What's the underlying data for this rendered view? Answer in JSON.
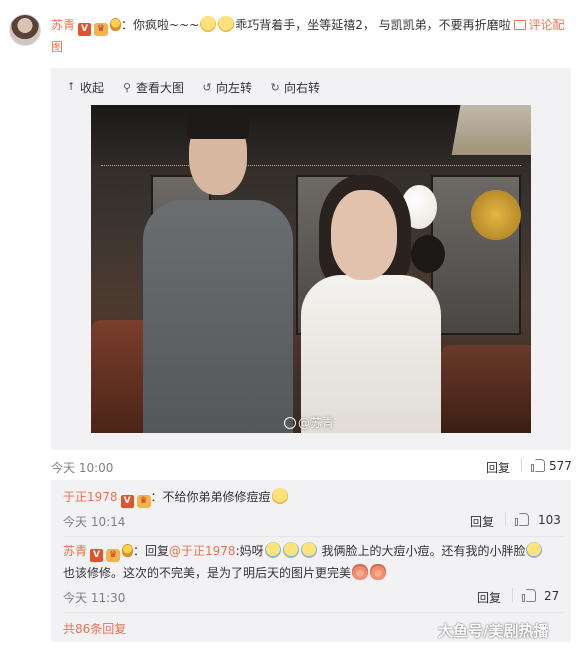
{
  "post": {
    "author": "苏青",
    "text_part1": "：你疯啦~~~",
    "text_part2": "乖巧背着手，坐等延禧2， 与凯凯弟，不要再折磨啦",
    "pic_link_a": "评论配",
    "pic_link_b": "图"
  },
  "toolbar": {
    "collapse": "收起",
    "view_large": "查看大图",
    "rotate_left": "向左转",
    "rotate_right": "向右转"
  },
  "photo": {
    "watermark": "@苏青"
  },
  "post_meta": {
    "time": "今天 10:00",
    "reply": "回复",
    "likes": "577"
  },
  "replies": [
    {
      "author": "于正1978",
      "text": "：不给你弟弟修修痘痘",
      "time": "今天 10:14",
      "reply": "回复",
      "likes": "103"
    },
    {
      "author": "苏青",
      "text_prefix": "：回复",
      "mention": "@于正1978",
      "text_mid": ":妈呀",
      "text_a": "我俩脸上的大痘小痘。还有我的小胖脸",
      "text_b": "也该修修。这次的不完美，是为了明后天的图片更完美",
      "time": "今天 11:30",
      "reply": "回复",
      "likes": "27"
    }
  ],
  "total_replies": "共86条回复",
  "site_watermark": "大鱼号/美剧热播",
  "colors": {
    "accent": "#eb7350",
    "reply_bg": "#f2f2f5",
    "muted": "#808080"
  }
}
